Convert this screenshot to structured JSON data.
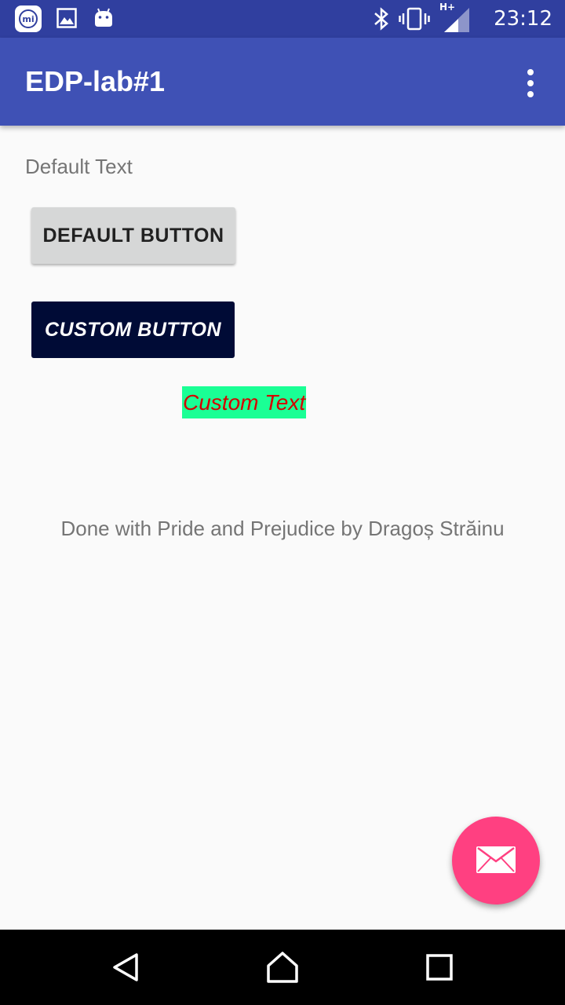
{
  "status_bar": {
    "time": "23:12",
    "left_icons": [
      "mi-icon",
      "gallery-icon",
      "android-icon"
    ],
    "right_icons": [
      "bluetooth-icon",
      "vibrate-icon",
      "signal-icon"
    ],
    "network_label": "H+"
  },
  "app_bar": {
    "title": "EDP-lab#1",
    "overflow_icon": "more-vert-icon"
  },
  "content": {
    "default_text": "Default Text",
    "default_button_label": "DEFAULT BUTTON",
    "custom_button_label": "CUSTOM BUTTON",
    "custom_text": "Custom Text",
    "footer_text": "Done with Pride and Prejudice by Dragoș Străinu"
  },
  "fab": {
    "icon": "mail-icon"
  },
  "nav_bar": {
    "icons": [
      "back-icon",
      "home-icon",
      "recents-icon"
    ]
  },
  "colors": {
    "status_bar": "#303f9f",
    "app_bar": "#3f51b5",
    "background": "#fafafa",
    "default_button": "#d6d7d7",
    "custom_button": "#000b36",
    "custom_text_bg": "#1aff95",
    "custom_text_fg": "#d50000",
    "fab": "#ff4081"
  }
}
